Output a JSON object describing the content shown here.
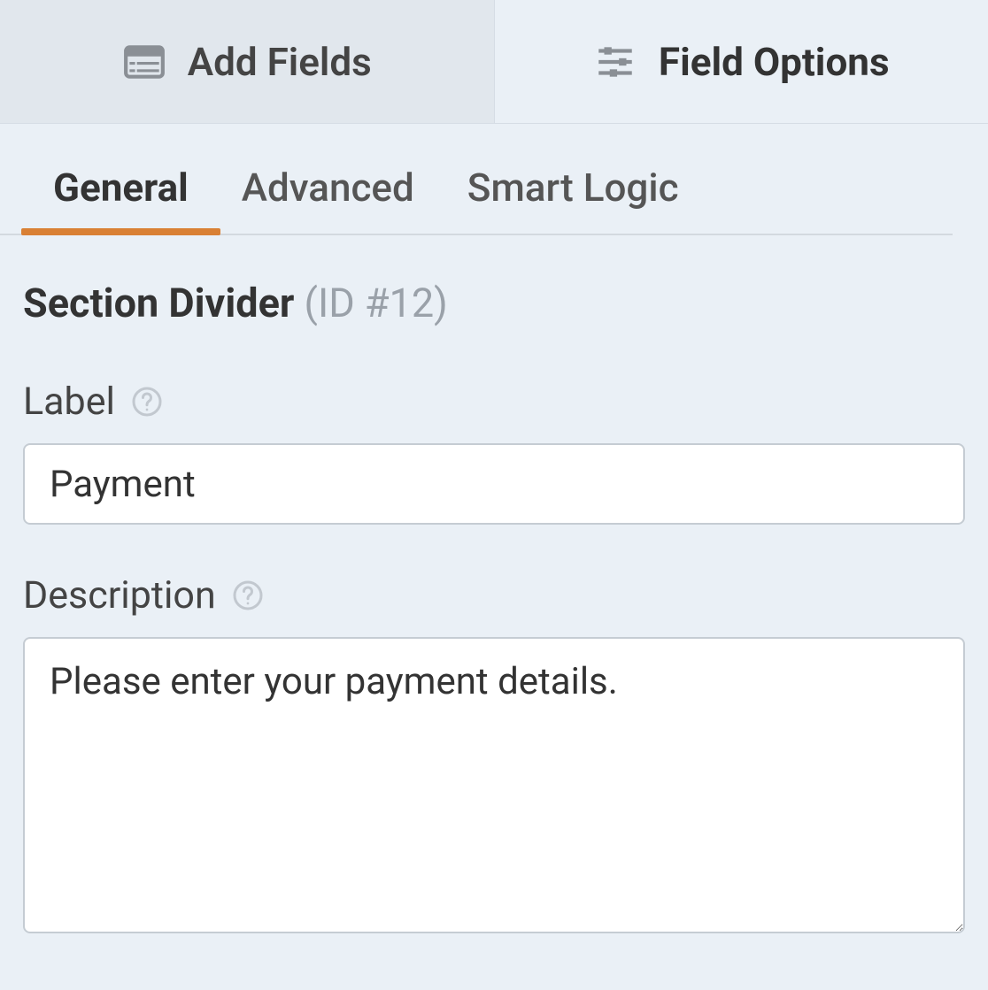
{
  "topTabs": {
    "addFields": "Add Fields",
    "fieldOptions": "Field Options"
  },
  "subTabs": {
    "general": "General",
    "advanced": "Advanced",
    "smartLogic": "Smart Logic"
  },
  "section": {
    "name": "Section Divider",
    "id": "(ID #12)"
  },
  "labelField": {
    "label": "Label",
    "value": "Payment"
  },
  "descriptionField": {
    "label": "Description",
    "value": "Please enter your payment details."
  }
}
